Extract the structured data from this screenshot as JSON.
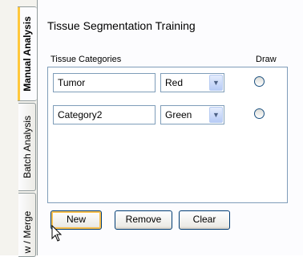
{
  "tabs": [
    {
      "label": "Manual Analysis",
      "active": true
    },
    {
      "label": "Batch Analysis",
      "active": false
    },
    {
      "label": "w / Merge",
      "active": false
    }
  ],
  "panel": {
    "title": "Tissue Segmentation Training",
    "header_categories": "Tissue Categories",
    "header_draw": "Draw"
  },
  "categories": [
    {
      "name": "Tumor",
      "color": "Red",
      "draw": false
    },
    {
      "name": "Category2",
      "color": "Green",
      "draw": false
    }
  ],
  "buttons": {
    "new": "New",
    "remove": "Remove",
    "clear": "Clear"
  },
  "icons": {
    "dropdown": "chevron-down-icon",
    "cursor": "mouse-pointer-icon"
  }
}
